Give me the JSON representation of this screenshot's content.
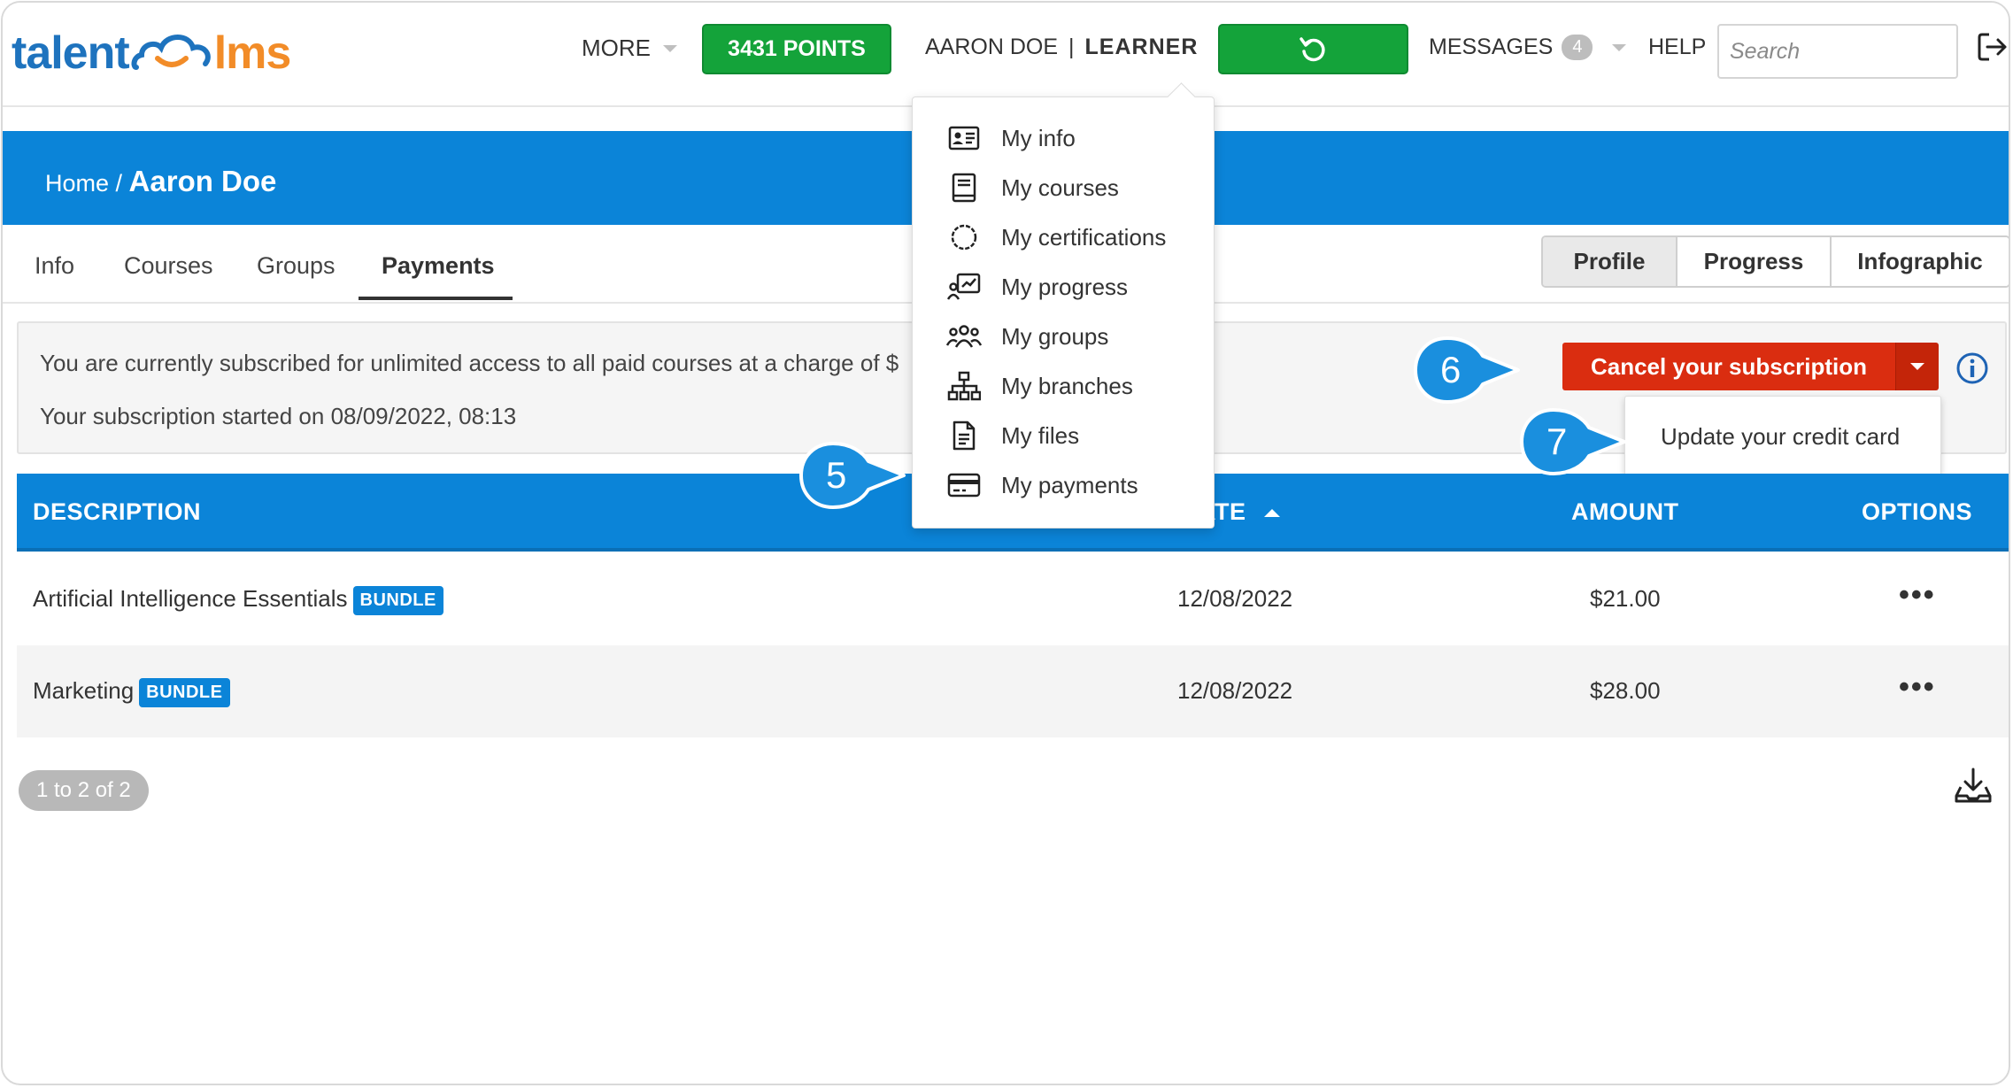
{
  "logo": {
    "part1": "talent",
    "part2": "lms"
  },
  "topbar": {
    "more_label": "MORE",
    "points_label": "3431 POINTS",
    "user_name": "AARON DOE",
    "user_separator": "|",
    "user_role": "LEARNER",
    "messages_label": "MESSAGES",
    "messages_count": "4",
    "help_label": "HELP",
    "search_placeholder": "Search"
  },
  "user_dropdown": {
    "items": [
      {
        "label": "My info",
        "icon": "id-card-icon"
      },
      {
        "label": "My courses",
        "icon": "book-icon"
      },
      {
        "label": "My certifications",
        "icon": "badge-icon"
      },
      {
        "label": "My progress",
        "icon": "progress-chart-icon"
      },
      {
        "label": "My groups",
        "icon": "users-icon"
      },
      {
        "label": "My branches",
        "icon": "sitemap-icon"
      },
      {
        "label": "My files",
        "icon": "file-icon"
      },
      {
        "label": "My payments",
        "icon": "credit-card-icon"
      }
    ]
  },
  "breadcrumb": {
    "home": "Home /",
    "current": "Aaron Doe"
  },
  "tabs": {
    "items": [
      "Info",
      "Courses",
      "Groups",
      "Payments"
    ],
    "active": "Payments",
    "view_buttons": [
      "Profile",
      "Progress",
      "Infographic"
    ],
    "active_view": "Profile"
  },
  "subscription": {
    "line1": "You are currently subscribed for unlimited access to all paid courses at a charge of $",
    "line2": "Your subscription started on 08/09/2022, 08:13",
    "cancel_label": "Cancel your subscription",
    "dropdown_item": "Update your credit card"
  },
  "table": {
    "headers": {
      "description": "DESCRIPTION",
      "date": "ATE",
      "amount": "AMOUNT",
      "options": "OPTIONS"
    },
    "sort": "date ascending",
    "rows": [
      {
        "description": "Artificial Intelligence Essentials",
        "tag": "BUNDLE",
        "date": "12/08/2022",
        "amount": "$21.00",
        "options": "•••"
      },
      {
        "description": "Marketing",
        "tag": "BUNDLE",
        "date": "12/08/2022",
        "amount": "$28.00",
        "options": "•••"
      }
    ],
    "pager": "1 to 2 of 2"
  },
  "callouts": {
    "c5": "5",
    "c6": "6",
    "c7": "7"
  },
  "colors": {
    "brand_blue": "#0b84d8",
    "points_green": "#14a33a",
    "cancel_red": "#da2d10",
    "callout_blue": "#1a8fde",
    "logo_orange": "#f28c28"
  }
}
